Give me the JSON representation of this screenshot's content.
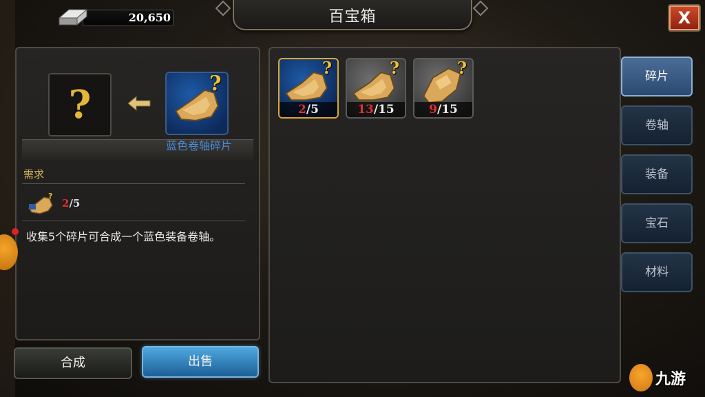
{
  "header": {
    "title": "百宝箱",
    "currency": {
      "icon": "silver-ingot-icon",
      "value": "20,650"
    },
    "close_label": "X"
  },
  "left_panel": {
    "result_slot": {
      "symbol": "?"
    },
    "source_item": {
      "name": "蓝色卷轴碎片",
      "icon": "blue-scroll-fragment-icon"
    },
    "requirement_label": "需求",
    "requirement": {
      "have": "2",
      "need": "/5"
    },
    "description": "收集5个碎片可合成一个蓝色装备卷轴。"
  },
  "actions": {
    "synthesize": "合成",
    "sell": "出售"
  },
  "inventory": [
    {
      "icon": "blue-scroll-fragment-icon",
      "have": "2",
      "need": "/5",
      "selected": true
    },
    {
      "icon": "gray-scroll-fragment-icon",
      "have": "13",
      "need": "/15",
      "selected": false
    },
    {
      "icon": "gray-gear-fragment-icon",
      "have": "9",
      "need": "/15",
      "selected": false
    }
  ],
  "tabs": [
    {
      "label": "碎片",
      "active": true
    },
    {
      "label": "卷轴",
      "active": false
    },
    {
      "label": "装备",
      "active": false
    },
    {
      "label": "宝石",
      "active": false
    },
    {
      "label": "材料",
      "active": false
    }
  ],
  "watermark": {
    "text": "九游"
  },
  "colors": {
    "accent_gold": "#e5b63a",
    "count_red": "#e03030",
    "name_blue": "#4a8ad6"
  }
}
